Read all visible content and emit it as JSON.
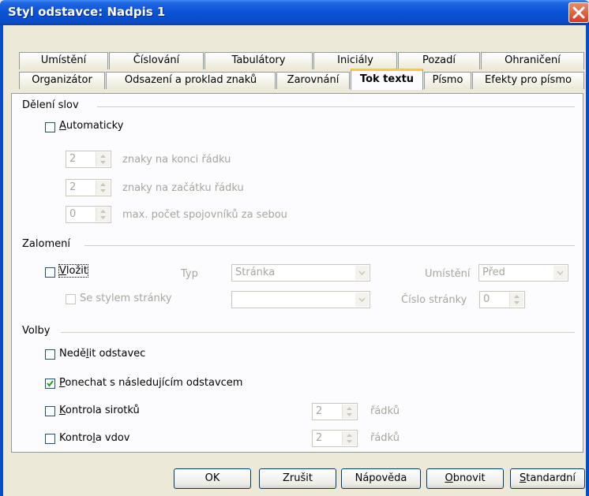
{
  "title": "Styl odstavce: Nadpis 1",
  "tabs_row1": [
    "Umístění",
    "Číslování",
    "Tabulátory",
    "Iniciály",
    "Pozadí",
    "Ohraničení"
  ],
  "tabs_row2": [
    "Organizátor",
    "Odsazení a proklad znaků",
    "Zarovnání",
    "Tok textu",
    "Písmo",
    "Efekty pro písmo"
  ],
  "active_tab": "Tok textu",
  "deleni": {
    "heading": "Dělení slov",
    "automaticky": "Automaticky",
    "automaticky_checked": false,
    "spin1_value": "2",
    "spin1_label": "znaky na konci řádku",
    "spin2_value": "2",
    "spin2_label": "znaky na začátku řádku",
    "spin3_value": "0",
    "spin3_label": "max. počet spojovníků za sebou"
  },
  "zalomeni": {
    "heading": "Zalomení",
    "vlozit": "Vložit",
    "vlozit_checked": false,
    "typ_label": "Typ",
    "typ_value": "Stránka",
    "umisteni_label": "Umístění",
    "umisteni_value": "Před",
    "se_stylem": "Se stylem stránky",
    "se_stylem_value": "",
    "cislo_label": "Číslo stránky",
    "cislo_value": "0"
  },
  "volby": {
    "heading": "Volby",
    "nedelit": "Nedělit odstavec",
    "nedelit_checked": false,
    "ponechat": "Ponechat s následujícím odstavcem",
    "ponechat_checked": true,
    "sirotky": "Kontrola sirotků",
    "sirotky_checked": false,
    "sirotky_value": "2",
    "sirotky_unit": "řádků",
    "vdovy": "Kontrola vdov",
    "vdovy_checked": false,
    "vdovy_value": "2",
    "vdovy_unit": "řádků"
  },
  "buttons": {
    "ok": "OK",
    "zrusit": "Zrušit",
    "napoveda": "Nápověda",
    "obnovit": "Obnovit",
    "standardni": "Standardní"
  }
}
